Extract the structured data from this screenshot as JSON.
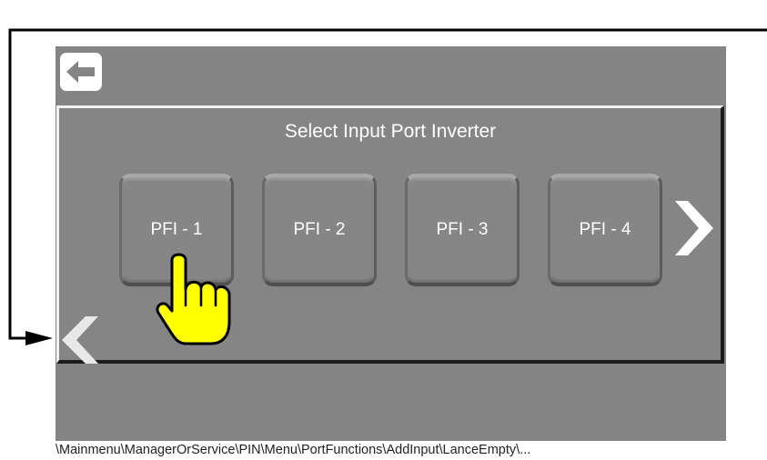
{
  "screen": {
    "title": "Select Input Port Inverter",
    "ports": [
      "PFI - 1",
      "PFI - 2",
      "PFI - 3",
      "PFI - 4"
    ]
  },
  "icons": {
    "back": "back-arrow-icon",
    "next": "chevron-right-icon",
    "prev": "chevron-left-icon",
    "pointer": "hand-pointer-icon"
  },
  "breadcrumb_path": "\\Mainmenu\\ManagerOrService\\PIN\\Menu\\PortFunctions\\AddInput\\LanceEmpty\\...",
  "colors": {
    "screen_bg": "#848485",
    "pointer_fill": "#ffff00",
    "text": "#ffffff"
  }
}
